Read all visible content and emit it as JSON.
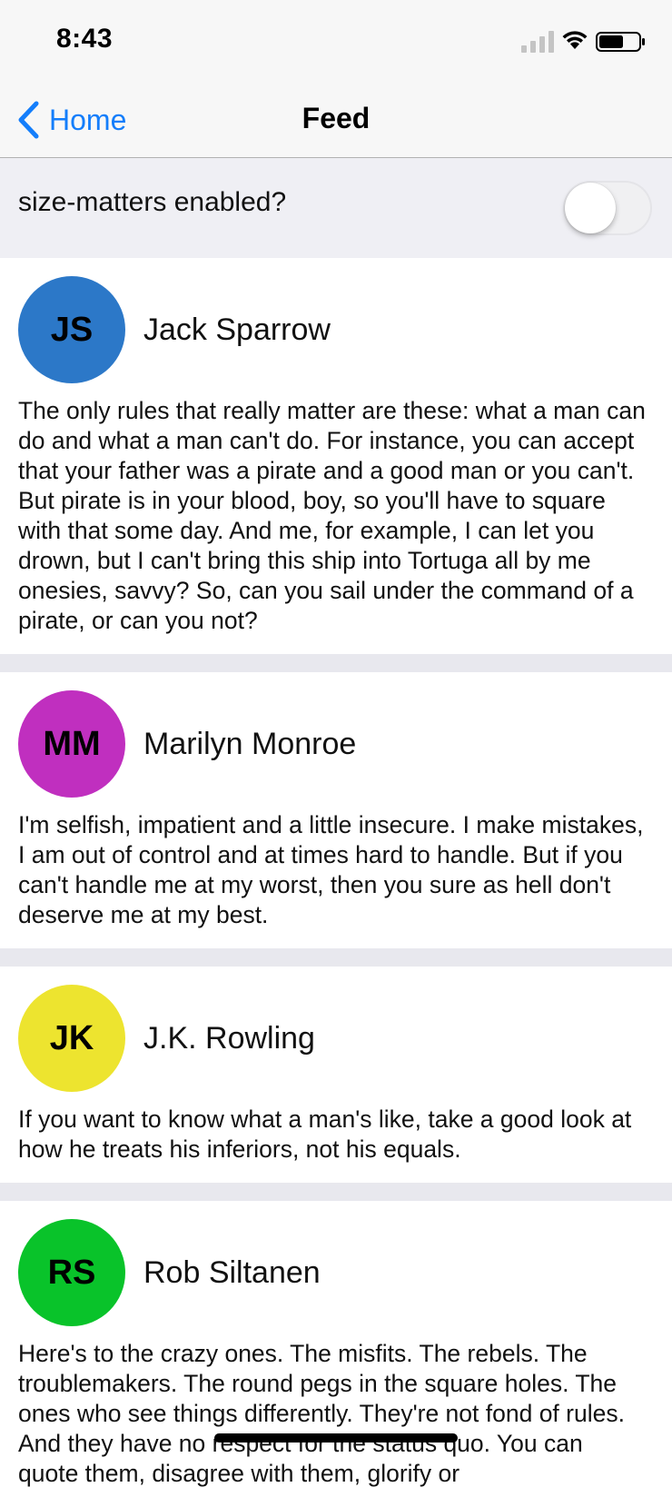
{
  "status_bar": {
    "time": "8:43",
    "icons": [
      "signal-icon",
      "wifi-icon",
      "battery-icon"
    ]
  },
  "nav": {
    "back_label": "Home",
    "back_icon": "chevron-left-icon",
    "title": "Feed",
    "accent_color": "#147efb"
  },
  "toggle": {
    "label": "size-matters enabled?",
    "state": "off"
  },
  "feed": [
    {
      "initials": "JS",
      "name": "Jack Sparrow",
      "color": "#2c78c8",
      "text": "The only rules that really matter are these: what a man can do and what a man can't do. For instance, you can accept that your father was a pirate and a good man or you can't. But pirate is in your blood, boy, so you'll have to square with that some day. And me, for example, I can let you drown, but I can't bring this ship into Tortuga all by me onesies, savvy? So, can you sail under the command of a pirate, or can you not?"
    },
    {
      "initials": "MM",
      "name": "Marilyn Monroe",
      "color": "#c02fbf",
      "text": "I'm selfish, impatient and a little insecure. I make mistakes, I am out of control and at times hard to handle. But if you can't handle me at my worst, then you sure as hell don't deserve me at my best."
    },
    {
      "initials": "JK",
      "name": "J.K. Rowling",
      "color": "#ede42f",
      "text": "If you want to know what a man's like, take a good look at how he treats his inferiors, not his equals."
    },
    {
      "initials": "RS",
      "name": "Rob Siltanen",
      "color": "#09c32a",
      "text": "Here's to the crazy ones. The misfits. The rebels. The troublemakers. The round pegs in the square holes. The ones who see things differently. They're not fond of rules. And they have no respect for the status quo. You can quote them, disagree with them, glorify or"
    }
  ]
}
